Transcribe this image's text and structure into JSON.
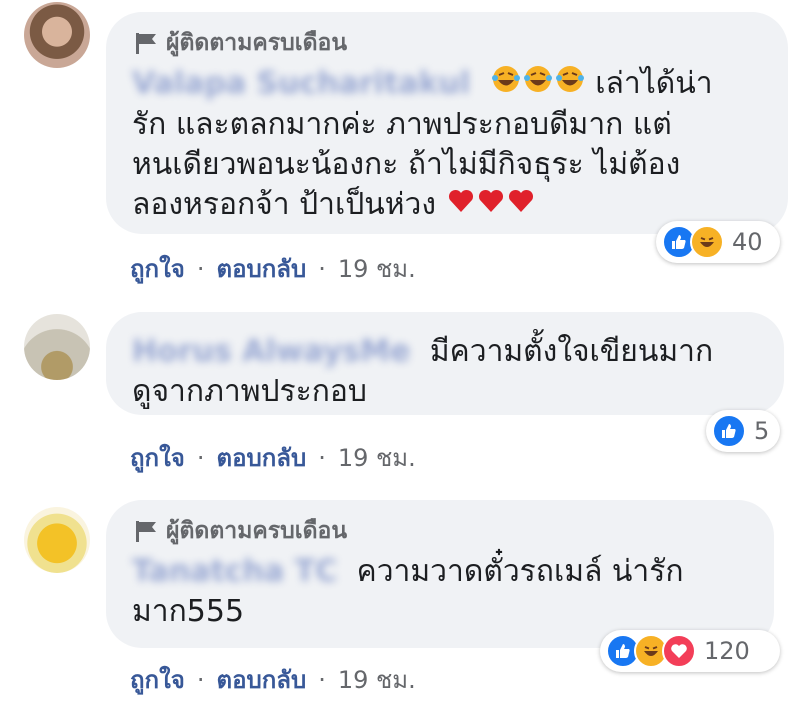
{
  "comments": [
    {
      "badge": "ผู้ติดตามครบเดือน",
      "author": "Valapa Sucharitakul",
      "text_pre": "เล่าได้น่า",
      "lines": [
        "รัก และตลกมากค่ะ ภาพประกอบดีมาก แต่",
        "หนเดียวพอนะน้องกะ ถ้าไม่มีกิจธุระ ไม่ต้อง",
        "ลองหรอกจ้า ป้าเป็นห่วง"
      ],
      "reaction_icons": [
        "like-icon",
        "haha-icon"
      ],
      "reaction_count": "40",
      "like_label": "ถูกใจ",
      "reply_label": "ตอบกลับ",
      "time": "19 ชม."
    },
    {
      "author": "Horus AlwaysMe",
      "text_pre": "มีความตั้งใจเขียนมาก",
      "lines": [
        "ดูจากภาพประกอบ"
      ],
      "reaction_icons": [
        "like-icon"
      ],
      "reaction_count": "5",
      "like_label": "ถูกใจ",
      "reply_label": "ตอบกลับ",
      "time": "19 ชม."
    },
    {
      "badge": "ผู้ติดตามครบเดือน",
      "author": "Tanatcha TC",
      "text_pre": "ความวาดตั๋วรถเมล์ น่ารัก",
      "lines": [
        "มาก555"
      ],
      "reaction_icons": [
        "like-icon",
        "haha-icon",
        "love-icon"
      ],
      "reaction_count": "120",
      "like_label": "ถูกใจ",
      "reply_label": "ตอบกลับ",
      "time": "19 ชม."
    }
  ],
  "colors": {
    "bubble": "#f0f2f5",
    "link": "#385898",
    "like": "#1877f2",
    "love": "#f33e58",
    "haha": "#f7b125"
  }
}
